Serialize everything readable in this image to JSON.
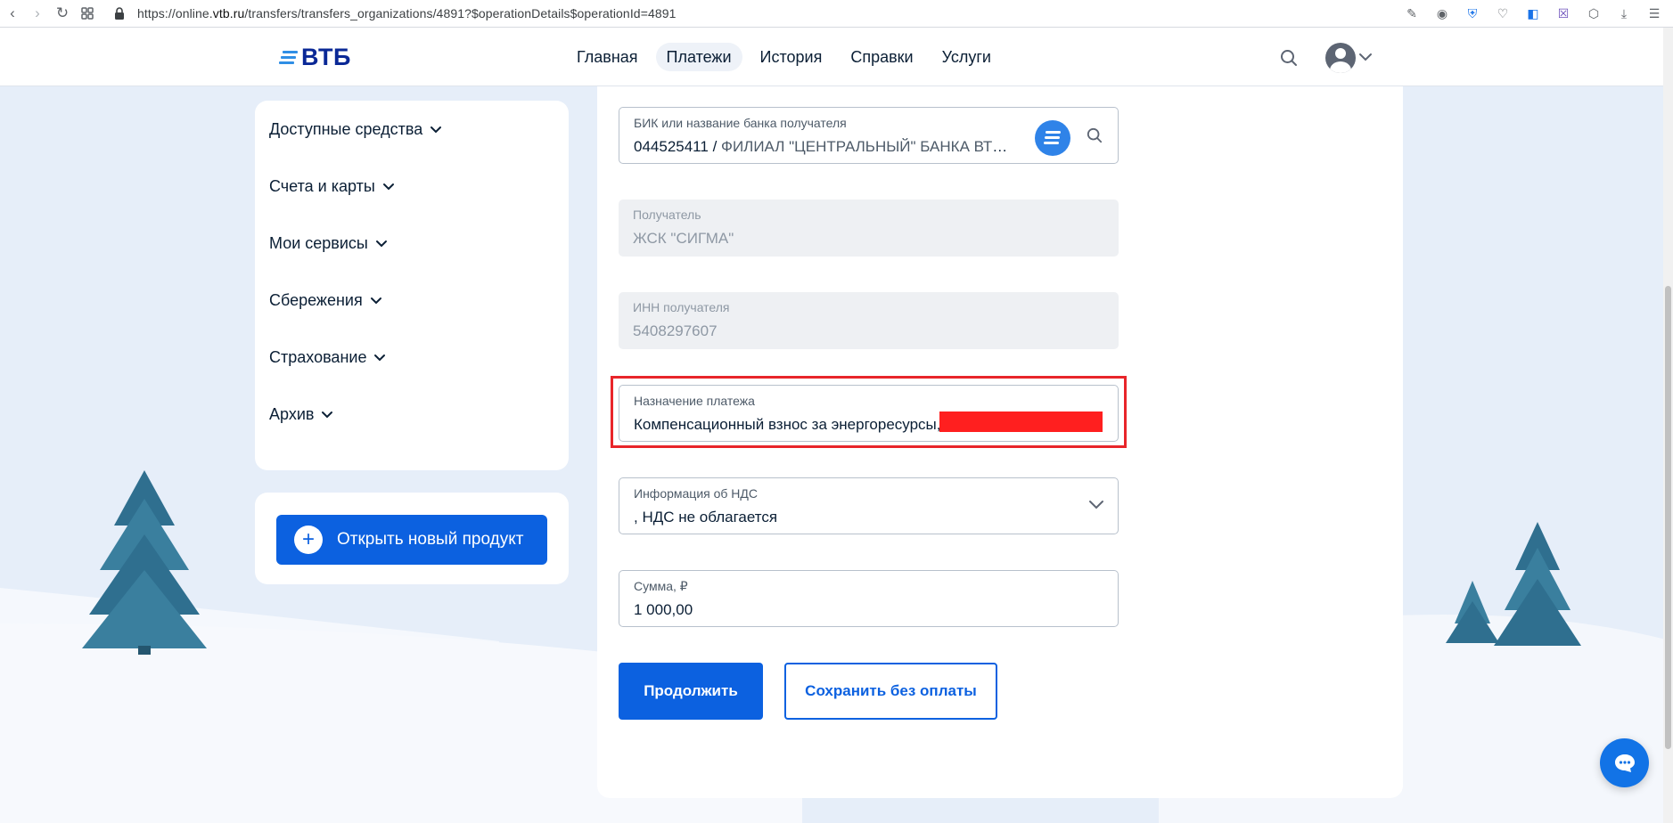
{
  "browser": {
    "url_prefix": "https://online.",
    "url_domain": "vtb.ru",
    "url_path": "/transfers/transfers_organizations/4891?$operationDetails$operationId=4891"
  },
  "header": {
    "logo": "ВТБ",
    "nav": [
      {
        "label": "Главная",
        "active": false
      },
      {
        "label": "Платежи",
        "active": true
      },
      {
        "label": "История",
        "active": false
      },
      {
        "label": "Справки",
        "active": false
      },
      {
        "label": "Услуги",
        "active": false
      }
    ]
  },
  "sidebar": {
    "items": [
      {
        "label": "Доступные средства"
      },
      {
        "label": "Счета и карты"
      },
      {
        "label": "Мои сервисы"
      },
      {
        "label": "Сбережения"
      },
      {
        "label": "Страхование"
      },
      {
        "label": "Архив"
      }
    ],
    "open_product_label": "Открыть новый продукт"
  },
  "form": {
    "bank": {
      "label": "БИК или название банка получателя",
      "bik": "044525411",
      "separator": " / ",
      "name": "ФИЛИАЛ \"ЦЕНТРАЛЬНЫЙ\" БАНКА ВТБ (П..."
    },
    "recipient": {
      "label": "Получатель",
      "value": "ЖСК \"СИГМА\""
    },
    "inn": {
      "label": "ИНН получателя",
      "value": "5408297607"
    },
    "purpose": {
      "label": "Назначение платежа",
      "value": "Компенсационный взнос за энергоресурсы,"
    },
    "vat": {
      "label": "Информация об НДС",
      "value": ", НДС не облагается"
    },
    "amount": {
      "label": "Сумма, ₽",
      "value": "1 000,00"
    },
    "continue_label": "Продолжить",
    "save_label": "Сохранить без оплаты"
  },
  "colors": {
    "brand_blue": "#0c61e0",
    "logo_blue": "#0a2896",
    "highlight_red": "#e8252a",
    "background": "#e9eff8"
  }
}
